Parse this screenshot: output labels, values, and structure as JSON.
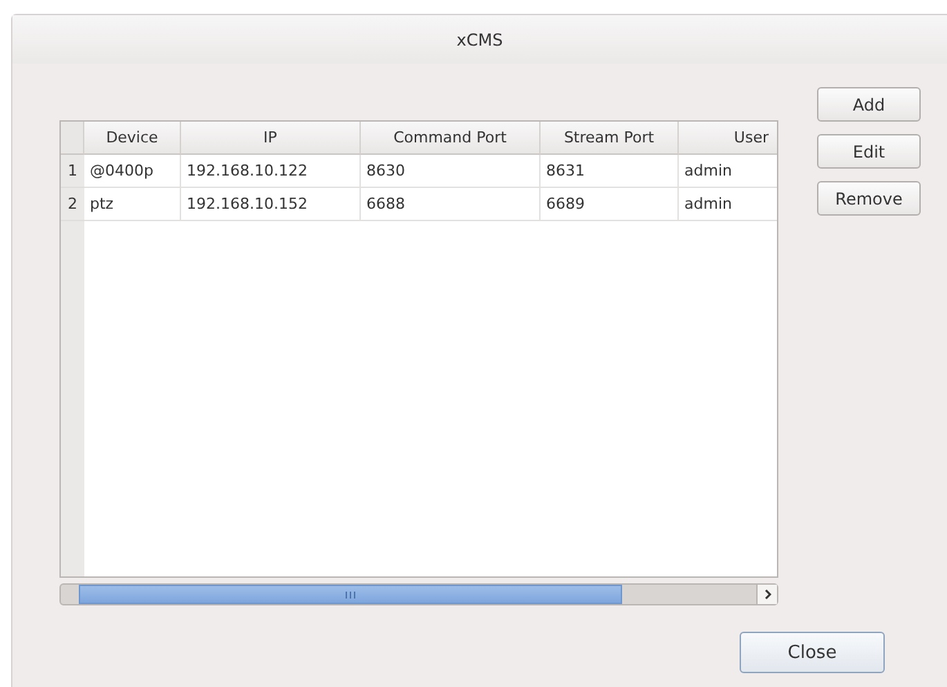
{
  "window": {
    "title": "xCMS"
  },
  "table": {
    "columns": [
      "Device",
      "IP",
      "Command Port",
      "Stream Port",
      "User"
    ],
    "rows": [
      {
        "number": "1",
        "cells": [
          "@0400p",
          "192.168.10.122",
          "8630",
          "8631",
          "admin"
        ]
      },
      {
        "number": "2",
        "cells": [
          "ptz",
          "192.168.10.152",
          "6688",
          "6689",
          "admin"
        ]
      }
    ]
  },
  "side_buttons": [
    "Add",
    "Edit",
    "Remove"
  ],
  "close_button": "Close"
}
